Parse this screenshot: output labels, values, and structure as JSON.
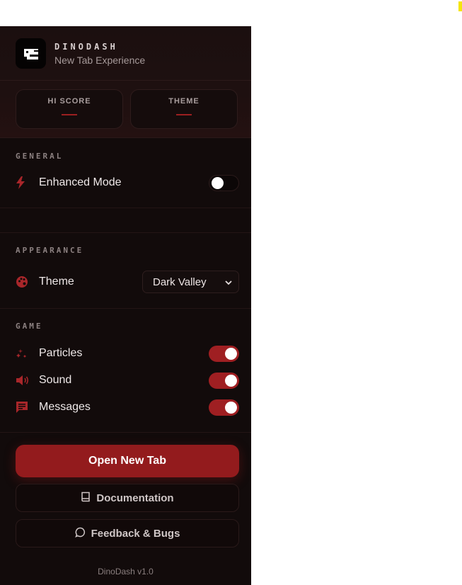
{
  "app": {
    "name": "DINODASH",
    "subtitle": "New Tab Experience"
  },
  "stats": [
    {
      "label": "HI SCORE",
      "value": "—"
    },
    {
      "label": "THEME",
      "value": "—"
    }
  ],
  "general": {
    "heading": "GENERAL",
    "enhanced_mode": {
      "label": "Enhanced Mode",
      "enabled": false,
      "icon": "bolt-icon"
    }
  },
  "appearance": {
    "heading": "APPEARANCE",
    "theme": {
      "label": "Theme",
      "selected": "Dark Valley",
      "icon": "palette-icon"
    }
  },
  "game": {
    "heading": "GAME",
    "items": [
      {
        "label": "Particles",
        "enabled": true,
        "icon": "sparkles-icon"
      },
      {
        "label": "Sound",
        "enabled": true,
        "icon": "speaker-icon"
      },
      {
        "label": "Messages",
        "enabled": true,
        "icon": "message-icon"
      }
    ]
  },
  "actions": {
    "open_new_tab": "Open New Tab",
    "documentation": "Documentation",
    "feedback": "Feedback & Bugs"
  },
  "footer": {
    "version": "DinoDash v1.0"
  },
  "colors": {
    "accent": "#931b1d",
    "background": "#120b0b",
    "toggle_on": "#9f1f22"
  }
}
